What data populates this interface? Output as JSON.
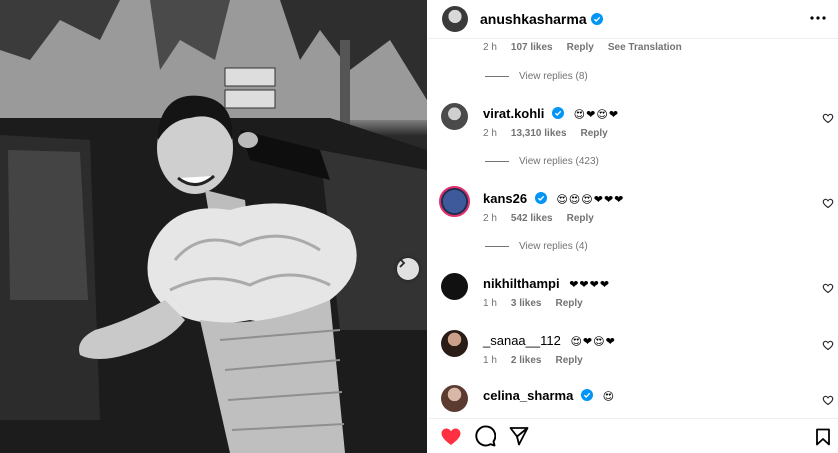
{
  "post": {
    "author": "anushkasharma",
    "author_verified": true
  },
  "top_meta": {
    "time": "2 h",
    "likes": "107 likes",
    "reply": "Reply",
    "see_translation": "See Translation"
  },
  "top_view_replies": "View replies (8)",
  "comments": [
    {
      "username": "virat.kohli",
      "verified": true,
      "text": "😍❤😍❤",
      "time": "2 h",
      "likes": "13,310 likes",
      "reply": "Reply",
      "view_replies": "View replies (423)"
    },
    {
      "username": "kans26",
      "verified": true,
      "text": "😍😍😍❤❤❤",
      "time": "2 h",
      "likes": "542 likes",
      "reply": "Reply",
      "view_replies": "View replies (4)"
    },
    {
      "username": "nikhilthampi",
      "verified": false,
      "text": "❤❤❤❤",
      "time": "1 h",
      "likes": "3 likes",
      "reply": "Reply"
    },
    {
      "username": "_sanaa__112",
      "verified": false,
      "text": "😍❤😍❤",
      "time": "1 h",
      "likes": "2 likes",
      "reply": "Reply"
    },
    {
      "username": "celina_sharma",
      "verified": true,
      "text": "😍"
    }
  ],
  "icons": {
    "more": "more-options-icon",
    "like_post": "heart-filled-icon",
    "comment": "comment-icon",
    "share": "share-icon",
    "save": "bookmark-icon",
    "carousel_next": "chevron-right-icon"
  },
  "colors": {
    "verified": "#0095f6",
    "like_red": "#ff3040",
    "muted": "#737373"
  }
}
